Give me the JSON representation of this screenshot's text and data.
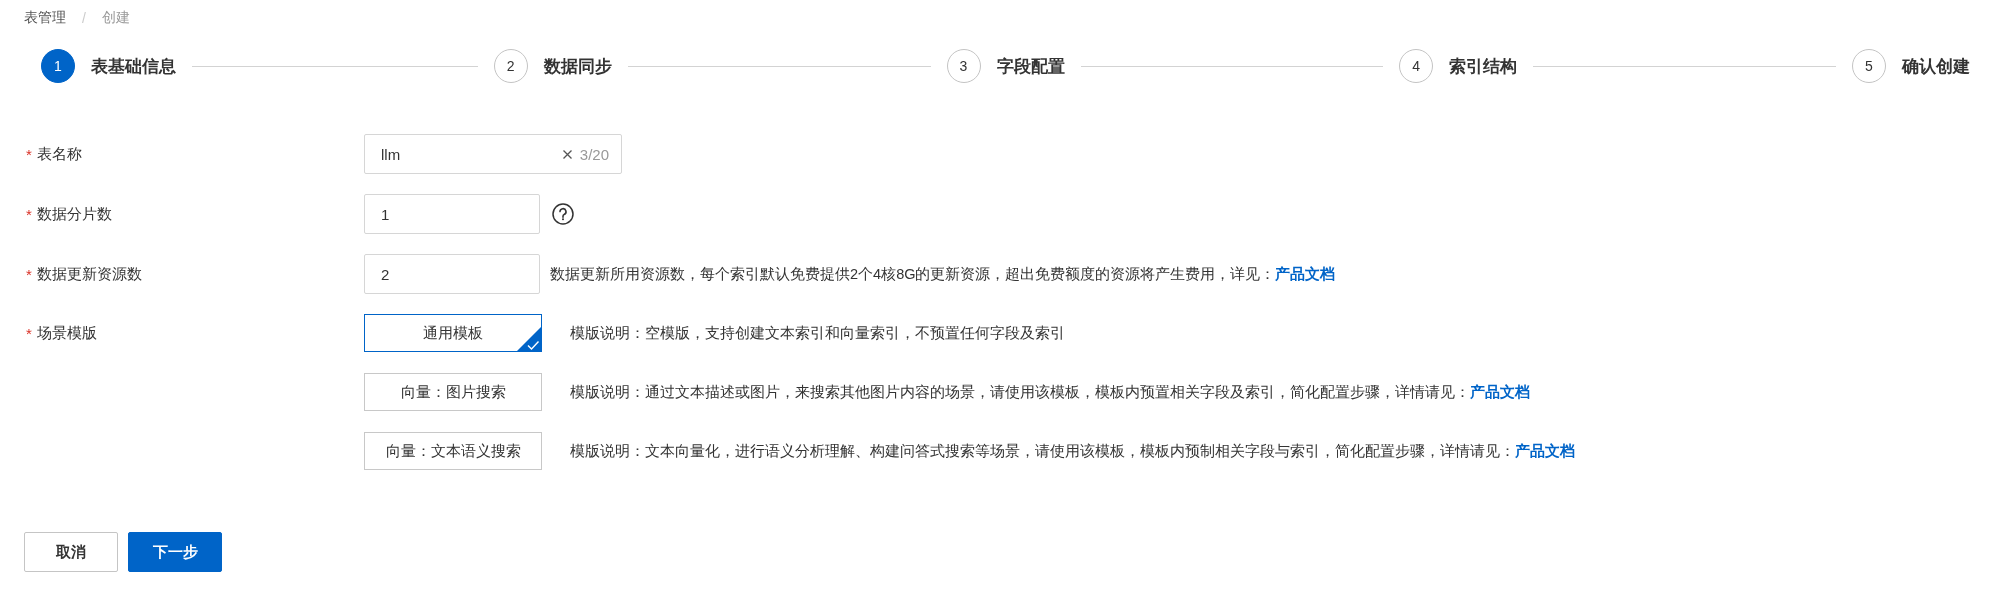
{
  "breadcrumb": {
    "separator": "/",
    "items": [
      {
        "label": "表管理",
        "current": false
      },
      {
        "label": "创建",
        "current": true
      }
    ]
  },
  "steps": [
    {
      "number": "1",
      "title": "表基础信息",
      "current": true
    },
    {
      "number": "2",
      "title": "数据同步",
      "current": false
    },
    {
      "number": "3",
      "title": "字段配置",
      "current": false
    },
    {
      "number": "4",
      "title": "索引结构",
      "current": false
    },
    {
      "number": "5",
      "title": "确认创建",
      "current": false
    }
  ],
  "form": {
    "required_mark": "*",
    "fields": [
      {
        "kind": "text",
        "label": "表名称",
        "required": true,
        "value": "llm",
        "clearable": true,
        "counter": "3/20"
      },
      {
        "kind": "number",
        "label": "数据分片数",
        "required": true,
        "value": "1",
        "help": true
      },
      {
        "kind": "number",
        "label": "数据更新资源数",
        "required": true,
        "value": "2",
        "note": "数据更新所用资源数，每个索引默认免费提供2个4核8G的更新资源，超出免费额度的资源将产生费用，详见：",
        "note_link": "产品文档"
      },
      {
        "kind": "templates",
        "label": "场景模版",
        "required": true,
        "options": [
          {
            "label": "通用模板",
            "selected": true,
            "description": "模版说明：空模版，支持创建文本索引和向量索引，不预置任何字段及索引"
          },
          {
            "label": "向量：图片搜索",
            "selected": false,
            "description": "模版说明：通过文本描述或图片，来搜索其他图片内容的场景，请使用该模板，模板内预置相关字段及索引，简化配置步骤，详情请见：",
            "link": "产品文档"
          },
          {
            "label": "向量：文本语义搜索",
            "selected": false,
            "description": "模版说明：文本向量化，进行语义分析理解、构建问答式搜索等场景，请使用该模板，模板内预制相关字段与索引，简化配置步骤，详情请见：",
            "link": "产品文档"
          }
        ]
      }
    ]
  },
  "actions": [
    {
      "label": "取消",
      "kind": "secondary"
    },
    {
      "label": "下一步",
      "kind": "primary"
    }
  ]
}
